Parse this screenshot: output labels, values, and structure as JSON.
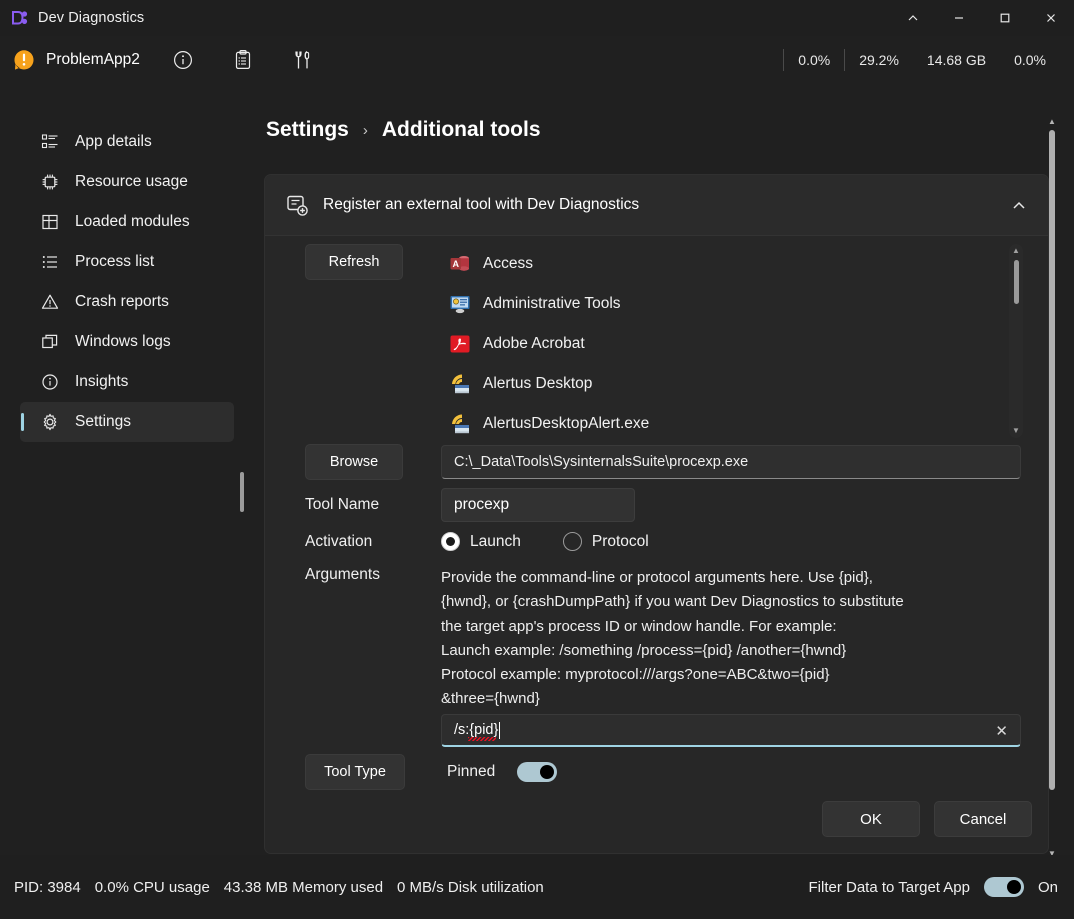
{
  "window": {
    "title": "Dev Diagnostics",
    "logo_icon": "dev-diagnostics-logo-icon",
    "controls": [
      {
        "name": "collapse-button",
        "glyph": "⌃"
      },
      {
        "name": "minimize-button",
        "glyph": "—"
      },
      {
        "name": "maximize-button",
        "glyph": "□"
      },
      {
        "name": "close-button",
        "glyph": "✕"
      }
    ]
  },
  "appbar": {
    "app_name": "ProblemApp2",
    "warning_icon": "warning-exclamation-icon",
    "icons": [
      {
        "name": "info-icon",
        "glyph": "ⓘ"
      },
      {
        "name": "clipboard-icon",
        "glyph": "clipboard"
      },
      {
        "name": "tools-icon",
        "glyph": "tools"
      }
    ],
    "stats": [
      {
        "name": "cpu-stat",
        "value": "0.0%"
      },
      {
        "name": "memory-percent-stat",
        "value": "29.2%"
      },
      {
        "name": "memory-size-stat",
        "value": "14.68 GB"
      },
      {
        "name": "disk-stat",
        "value": "0.0%"
      }
    ]
  },
  "sidebar": {
    "items": [
      {
        "label": "App details",
        "icon": "list-details-icon",
        "selected": false
      },
      {
        "label": "Resource usage",
        "icon": "cpu-chip-icon",
        "selected": false
      },
      {
        "label": "Loaded modules",
        "icon": "modules-grid-icon",
        "selected": false
      },
      {
        "label": "Process list",
        "icon": "bulleted-list-icon",
        "selected": false
      },
      {
        "label": "Crash reports",
        "icon": "warning-triangle-icon",
        "selected": false
      },
      {
        "label": "Windows logs",
        "icon": "windows-copy-icon",
        "selected": false
      },
      {
        "label": "Insights",
        "icon": "info-circle-icon",
        "selected": false
      },
      {
        "label": "Settings",
        "icon": "gear-icon",
        "selected": true
      }
    ]
  },
  "breadcrumb": {
    "root": "Settings",
    "separator": "›",
    "current": "Additional tools"
  },
  "card": {
    "title": "Register an external tool with Dev Diagnostics",
    "header_icon": "register-tool-icon",
    "chevron": "⌃",
    "refresh_label": "Refresh",
    "app_list": [
      {
        "label": "Access",
        "icon": "access-icon"
      },
      {
        "label": "Administrative Tools",
        "icon": "administrative-tools-icon"
      },
      {
        "label": "Adobe Acrobat",
        "icon": "adobe-acrobat-icon"
      },
      {
        "label": "Alertus Desktop",
        "icon": "alertus-icon"
      },
      {
        "label": "AlertusDesktopAlert.exe",
        "icon": "alertus-icon"
      }
    ],
    "browse_label": "Browse",
    "path_value": "C:\\_Data\\Tools\\SysinternalsSuite\\procexp.exe",
    "tool_name_label": "Tool Name",
    "tool_name_value": "procexp",
    "activation_label": "Activation",
    "activation_options": [
      {
        "label": "Launch",
        "checked": true
      },
      {
        "label": "Protocol",
        "checked": false
      }
    ],
    "arguments_label": "Arguments",
    "arguments_description": [
      "Provide the command-line or protocol arguments here. Use {pid},",
      "{hwnd}, or {crashDumpPath} if you want Dev Diagnostics to substitute",
      "the target app's process ID or window handle. For example:",
      "Launch example:  /something /process={pid} /another={hwnd}",
      "Protocol example:  myprotocol:///args?one=ABC&two={pid}",
      "&three={hwnd}"
    ],
    "arguments_value": "/s:{pid}",
    "arguments_clear_icon": "✕",
    "tool_type_label": "Tool Type",
    "pinned_label": "Pinned",
    "pinned_on": true,
    "ok_label": "OK",
    "cancel_label": "Cancel"
  },
  "statusbar": {
    "pid": "PID: 3984",
    "cpu": "0.0% CPU usage",
    "memory": "43.38 MB Memory used",
    "disk": "0 MB/s Disk utilization",
    "filter_label": "Filter Data to Target App",
    "filter_state": "On"
  },
  "colors": {
    "accent": "#9fd4e4",
    "background": "#202020",
    "card": "#2b2b2b",
    "card_body": "#272727",
    "spell_error": "#e81123"
  }
}
